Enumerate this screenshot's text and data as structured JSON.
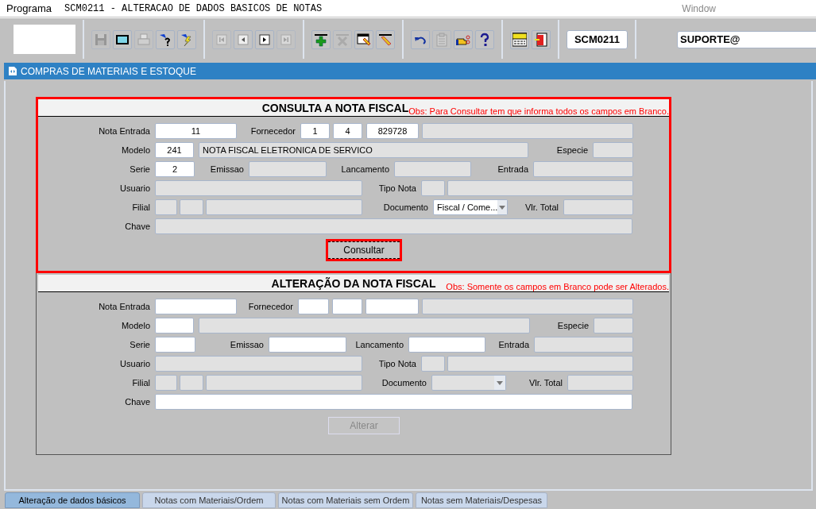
{
  "title_bar": {
    "menu": "Programa",
    "title": "SCM0211 - ALTERACAO DE DADOS BASICOS DE NOTAS",
    "window_menu": "Window"
  },
  "toolbar": {
    "groups": [
      [
        {
          "kind": "save",
          "disabled": true
        },
        {
          "kind": "screen",
          "disabled": false
        },
        {
          "kind": "print",
          "disabled": true
        },
        {
          "kind": "query",
          "disabled": false
        },
        {
          "kind": "execute",
          "disabled": false
        }
      ],
      [
        {
          "kind": "first",
          "disabled": true
        },
        {
          "kind": "previous",
          "disabled": false
        },
        {
          "kind": "next",
          "disabled": false
        },
        {
          "kind": "last",
          "disabled": true
        }
      ],
      [
        {
          "kind": "insert",
          "disabled": false
        },
        {
          "kind": "delete",
          "disabled": true
        },
        {
          "kind": "edit",
          "disabled": false
        },
        {
          "kind": "erase",
          "disabled": false
        }
      ],
      [
        {
          "kind": "undo",
          "disabled": false
        },
        {
          "kind": "clipboard",
          "disabled": true
        },
        {
          "kind": "pointer",
          "disabled": false
        },
        {
          "kind": "help",
          "disabled": false
        }
      ],
      [
        {
          "kind": "menu",
          "disabled": false
        },
        {
          "kind": "exit",
          "disabled": false
        }
      ]
    ],
    "program_code": "SCM0211",
    "user": "SUPORTE@"
  },
  "banner": "COMPRAS DE MATERIAIS E ESTOQUE",
  "sections": [
    {
      "title": "CONSULTA A NOTA FISCAL",
      "note": "Obs: Para Consultar tem que informa todos os campos em Branco.",
      "highlighted": true,
      "lines": [
        {
          "fields": [
            {
              "label": "Nota Entrada",
              "inputs": [
                {
                  "kind": "field",
                  "value": "11",
                  "disabled": false
                }
              ]
            },
            {
              "label": "Fornecedor",
              "inputs": [
                {
                  "kind": "field",
                  "value": "1",
                  "disabled": false
                },
                {
                  "kind": "field",
                  "value": "4",
                  "disabled": false
                },
                {
                  "kind": "field",
                  "value": "829728",
                  "disabled": false
                },
                {
                  "kind": "field",
                  "disabled": true
                }
              ]
            }
          ]
        },
        {
          "fields": [
            {
              "label": "Modelo",
              "inputs": [
                {
                  "kind": "field",
                  "value": "241",
                  "disabled": false
                },
                {
                  "kind": "field",
                  "value": "NOTA FISCAL ELETRONICA DE SERVICO",
                  "disabled": true
                }
              ]
            },
            {
              "label": "Especie",
              "inputs": [
                {
                  "kind": "field",
                  "disabled": true
                }
              ]
            }
          ]
        },
        {
          "fields": [
            {
              "label": "Serie",
              "inputs": [
                {
                  "kind": "field",
                  "value": "2",
                  "disabled": false
                }
              ]
            },
            {
              "label": "Emissao",
              "inputs": [
                {
                  "kind": "field",
                  "disabled": true
                }
              ]
            },
            {
              "label": "Lancamento",
              "inputs": [
                {
                  "kind": "field",
                  "disabled": true
                }
              ]
            },
            {
              "label": "Entrada",
              "inputs": [
                {
                  "kind": "field",
                  "disabled": true
                }
              ]
            }
          ]
        },
        {
          "fields": [
            {
              "label": "Usuario",
              "inputs": [
                {
                  "kind": "field",
                  "disabled": true
                }
              ]
            },
            {
              "label": "Tipo Nota",
              "inputs": [
                {
                  "kind": "field",
                  "disabled": true
                },
                {
                  "kind": "field",
                  "disabled": true
                }
              ]
            }
          ]
        },
        {
          "fields": [
            {
              "label": "Filial",
              "inputs": [
                {
                  "kind": "field",
                  "disabled": true
                },
                {
                  "kind": "field",
                  "disabled": true
                },
                {
                  "kind": "field",
                  "disabled": true
                }
              ]
            },
            {
              "label": "Documento",
              "inputs": [
                {
                  "kind": "select",
                  "value": "Fiscal / Come...",
                  "disabled": false
                }
              ]
            },
            {
              "label": "Vlr. Total",
              "inputs": [
                {
                  "kind": "field",
                  "disabled": true
                }
              ]
            }
          ]
        },
        {
          "fields": [
            {
              "label": "Chave",
              "inputs": [
                {
                  "kind": "field",
                  "disabled": true
                }
              ]
            }
          ]
        }
      ],
      "button": {
        "label": "Consultar",
        "disabled": false,
        "highlighted": true
      }
    },
    {
      "title": "ALTERAÇÃO DA NOTA FISCAL",
      "note": "Obs: Somente os campos em Branco pode ser Alterados.",
      "highlighted": false,
      "lines": [
        {
          "fields": [
            {
              "label": "Nota Entrada",
              "inputs": [
                {
                  "kind": "field",
                  "disabled": false
                }
              ]
            },
            {
              "label": "Fornecedor",
              "inputs": [
                {
                  "kind": "field",
                  "disabled": false
                },
                {
                  "kind": "field",
                  "disabled": false
                },
                {
                  "kind": "field",
                  "disabled": false
                },
                {
                  "kind": "field",
                  "disabled": true
                }
              ]
            }
          ]
        },
        {
          "fields": [
            {
              "label": "Modelo",
              "inputs": [
                {
                  "kind": "field",
                  "disabled": false
                },
                {
                  "kind": "field",
                  "disabled": true
                }
              ]
            },
            {
              "label": "Especie",
              "inputs": [
                {
                  "kind": "field",
                  "disabled": true
                }
              ]
            }
          ]
        },
        {
          "fields": [
            {
              "label": "Serie",
              "inputs": [
                {
                  "kind": "field",
                  "disabled": false
                }
              ]
            },
            {
              "label": "Emissao",
              "inputs": [
                {
                  "kind": "field",
                  "disabled": false
                }
              ]
            },
            {
              "label": "Lancamento",
              "inputs": [
                {
                  "kind": "field",
                  "disabled": false
                }
              ]
            },
            {
              "label": "Entrada",
              "inputs": [
                {
                  "kind": "field",
                  "disabled": true
                }
              ]
            }
          ]
        },
        {
          "fields": [
            {
              "label": "Usuario",
              "inputs": [
                {
                  "kind": "field",
                  "disabled": true
                }
              ]
            },
            {
              "label": "Tipo Nota",
              "inputs": [
                {
                  "kind": "field",
                  "disabled": true
                },
                {
                  "kind": "field",
                  "disabled": true
                }
              ]
            }
          ]
        },
        {
          "fields": [
            {
              "label": "Filial",
              "inputs": [
                {
                  "kind": "field",
                  "disabled": true
                },
                {
                  "kind": "field",
                  "disabled": true
                },
                {
                  "kind": "field",
                  "disabled": true
                }
              ]
            },
            {
              "label": "Documento",
              "inputs": [
                {
                  "kind": "select",
                  "disabled": true
                }
              ]
            },
            {
              "label": "Vlr. Total",
              "inputs": [
                {
                  "kind": "field",
                  "disabled": true
                }
              ]
            }
          ]
        },
        {
          "fields": [
            {
              "label": "Chave",
              "inputs": [
                {
                  "kind": "field",
                  "disabled": false
                }
              ]
            }
          ]
        }
      ],
      "button": {
        "label": "Alterar",
        "disabled": true,
        "highlighted": false
      }
    }
  ],
  "tabs": [
    {
      "label": "Alteração de dados básicos",
      "selected": true
    },
    {
      "label": "Notas com Materiais/Ordem",
      "selected": false
    },
    {
      "label": "Notas com Materiais sem Ordem",
      "selected": false
    },
    {
      "label": "Notas sem Materiais/Despesas",
      "selected": false
    }
  ]
}
